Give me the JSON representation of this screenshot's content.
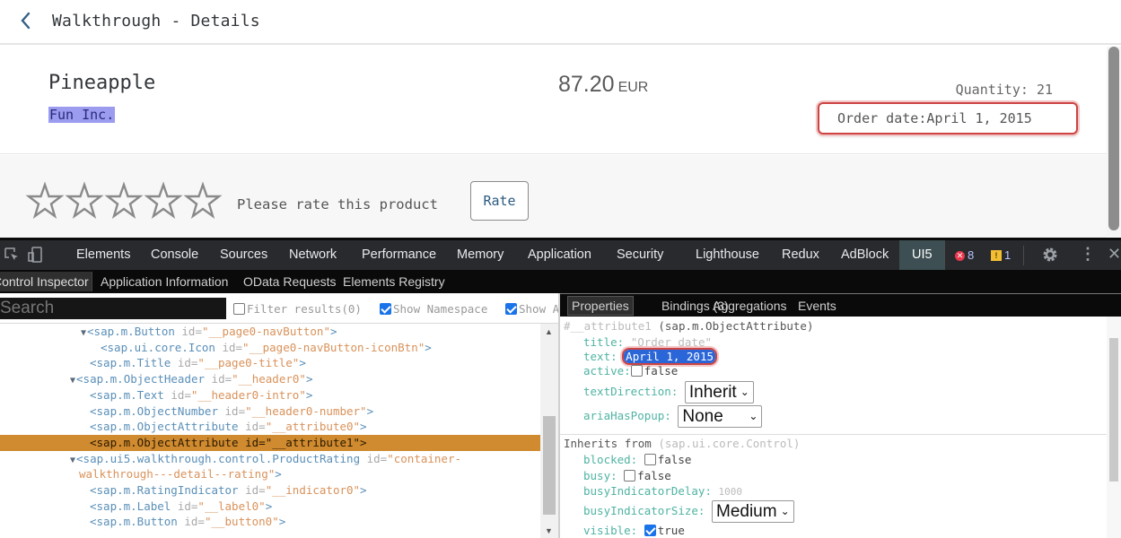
{
  "app": {
    "header": {
      "title": "Walkthrough - Details",
      "back_icon": "chevron-left-icon"
    },
    "object_header": {
      "title": "Pineapple",
      "intro": "Fun Inc.",
      "number": "87.20",
      "unit": "EUR",
      "attributes": [
        {
          "title": "Quantity",
          "text": "21"
        },
        {
          "title": "Order date",
          "text": "April 1, 2015"
        }
      ]
    },
    "rating": {
      "value": 0,
      "max": 5,
      "label": "Please rate this product",
      "button_label": "Rate"
    }
  },
  "devtools": {
    "tabs": [
      "Elements",
      "Console",
      "Sources",
      "Network",
      "Performance",
      "Memory",
      "Application",
      "Security",
      "Lighthouse",
      "Redux",
      "AdBlock",
      "UI5"
    ],
    "active_tab": "UI5",
    "error_count": "8",
    "warning_count": "1",
    "ui5_subtabs": [
      "Control Inspector",
      "Application Information",
      "OData Requests",
      "Elements Registry"
    ],
    "active_subtab": "Control Inspector",
    "search": {
      "placeholder": "Search",
      "value": ""
    },
    "options": [
      {
        "label": "Filter results(0)",
        "checked": false
      },
      {
        "label": "Show Namespace",
        "checked": true
      },
      {
        "label": "Show Attributes",
        "checked": true
      }
    ],
    "tree": [
      {
        "expanded": true,
        "tag": "<sap.m.Button",
        "attr": "id=",
        "val": "\"__page0-navButton\"",
        "close": ">"
      },
      {
        "expanded": null,
        "tag": "<sap.ui.core.Icon",
        "attr": "id=",
        "val": "\"__page0-navButton-iconBtn\"",
        "close": ">"
      },
      {
        "expanded": null,
        "tag": "<sap.m.Title",
        "attr": "id=",
        "val": "\"__page0-title\"",
        "close": ">"
      },
      {
        "expanded": true,
        "tag": "<sap.m.ObjectHeader",
        "attr": "id=",
        "val": "\"__header0\"",
        "close": ">"
      },
      {
        "expanded": null,
        "tag": "<sap.m.Text",
        "attr": "id=",
        "val": "\"__header0-intro\"",
        "close": ">"
      },
      {
        "expanded": null,
        "tag": "<sap.m.ObjectNumber",
        "attr": "id=",
        "val": "\"__header0-number\"",
        "close": ">"
      },
      {
        "expanded": null,
        "tag": "<sap.m.ObjectAttribute",
        "attr": "id=",
        "val": "\"__attribute0\"",
        "close": ">"
      },
      {
        "expanded": null,
        "tag": "<sap.m.ObjectAttribute",
        "attr": "id=",
        "val": "\"__attribute1\"",
        "close": ">",
        "selected": true
      },
      {
        "expanded": true,
        "tag": "<sap.ui5.walkthrough.control.ProductRating",
        "attr": "id=",
        "val": "\"container-",
        "close": ""
      },
      {
        "expanded": null,
        "tag": "",
        "attr": "",
        "val": "walkthrough---detail--rating\"",
        "close": ">"
      },
      {
        "expanded": null,
        "tag": "<sap.m.RatingIndicator",
        "attr": "id=",
        "val": "\"__indicator0\"",
        "close": ">"
      },
      {
        "expanded": null,
        "tag": "<sap.m.Label",
        "attr": "id=",
        "val": "\"__label0\"",
        "close": ">"
      },
      {
        "expanded": null,
        "tag": "<sap.m.Button",
        "attr": "id=",
        "val": "\"__button0\"",
        "close": ">"
      }
    ],
    "properties_tabs": [
      "Properties",
      "Bindings (3)",
      "Aggregations",
      "Events"
    ],
    "active_properties_tab": "Properties",
    "properties": {
      "header_id": "#__attribute1",
      "header_type": "(sap.m.ObjectAttribute)",
      "own": {
        "title_key": "title:",
        "title_value": "\"Order date\"",
        "text_key": "text:",
        "text_value": "April 1, 2015",
        "active_key": "active:",
        "active_value": "false",
        "textDirection_key": "textDirection:",
        "textDirection_value": "Inherit",
        "ariaHasPopup_key": "ariaHasPopup:",
        "ariaHasPopup_value": "None"
      },
      "inherits_label": "Inherits from",
      "inherits_type": "(sap.ui.core.Control)",
      "inherited": {
        "blocked_key": "blocked:",
        "blocked_value": "false",
        "busy_key": "busy:",
        "busy_value": "false",
        "busyIndicatorDelay_key": "busyIndicatorDelay:",
        "busyIndicatorDelay_value": "1000",
        "busyIndicatorSize_key": "busyIndicatorSize:",
        "busyIndicatorSize_value": "Medium",
        "visible_key": "visible:",
        "visible_value": "true"
      }
    }
  }
}
